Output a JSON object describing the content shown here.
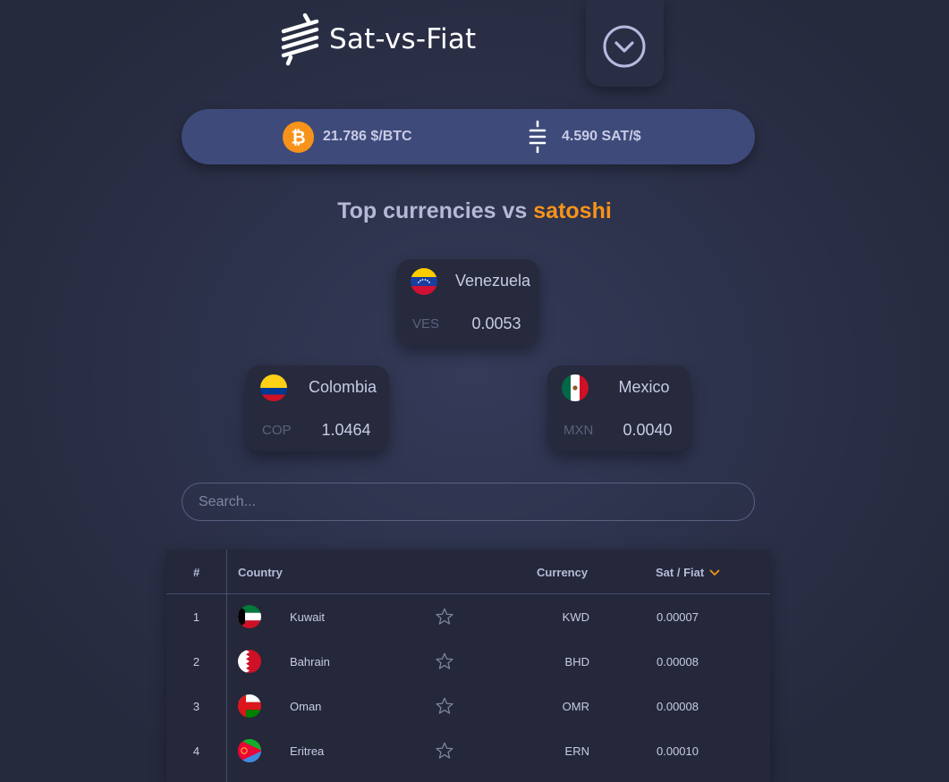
{
  "app": {
    "title": "Sat-vs-Fiat"
  },
  "ticker": {
    "btc_price": "21.786 $/BTC",
    "sat_per_dollar": "4.590 SAT/$"
  },
  "section": {
    "title_prefix": "Top currencies vs",
    "title_accent": "satoshi"
  },
  "top_currencies": [
    {
      "country": "Venezuela",
      "code": "VES",
      "value": "0.0053"
    },
    {
      "country": "Colombia",
      "code": "COP",
      "value": "1.0464"
    },
    {
      "country": "Mexico",
      "code": "MXN",
      "value": "0.0040"
    }
  ],
  "search": {
    "placeholder": "Search..."
  },
  "table": {
    "headers": {
      "rank": "#",
      "country": "Country",
      "currency": "Currency",
      "sat_fiat": "Sat / Fiat"
    },
    "rows": [
      {
        "rank": "1",
        "country": "Kuwait",
        "currency": "KWD",
        "sat_fiat": "0.00007"
      },
      {
        "rank": "2",
        "country": "Bahrain",
        "currency": "BHD",
        "sat_fiat": "0.00008"
      },
      {
        "rank": "3",
        "country": "Oman",
        "currency": "OMR",
        "sat_fiat": "0.00008"
      },
      {
        "rank": "4",
        "country": "Eritrea",
        "currency": "ERN",
        "sat_fiat": "0.00010"
      }
    ]
  },
  "colors": {
    "accent": "#f7931a",
    "background": "#2c314a",
    "ticker_bar": "#3e4a7a",
    "card": "#262a3c"
  },
  "icons": [
    "satoshi-logo-icon",
    "chevron-down-circle-icon",
    "bitcoin-icon",
    "satoshi-icon",
    "sort-down-icon",
    "star-icon"
  ]
}
